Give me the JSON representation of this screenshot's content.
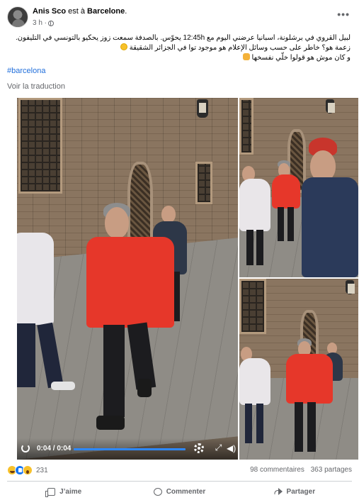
{
  "post": {
    "author": "Anis Sco",
    "author_suffix": " est à ",
    "location": "Barcelone",
    "location_end": ".",
    "time": "3 h ·",
    "more_icon": "more-options-icon",
    "privacy_icon": "globe-icon",
    "text_lines": [
      "لبيل القروي في برشلونة، اسبانيا عرضني اليوم مع 12:45h يحوّس. بالصدفة سمعت زوز يحكيو بالتونسي في التليفون.",
      "زعمة هو؟ خاطر على حسب وسائل الإعلام هو موجود توا في الجزائر الشقيقة",
      "و كان موش هو قولوا خلّي نفسخها"
    ],
    "hashtag": "#barcelona",
    "translate_link": "Voir la traduction"
  },
  "video": {
    "time": "0:04 / 0:04",
    "progress": 1.0,
    "progress_color": "#2d88ff",
    "icons": [
      "replay-icon",
      "gear-icon",
      "fullscreen-icon",
      "volume-icon"
    ]
  },
  "stats": {
    "reactions": [
      "haha",
      "like",
      "wow"
    ],
    "reaction_count": "231",
    "comments": "98 commentaires",
    "shares": "363 partages"
  },
  "actions": {
    "like": "J’aime",
    "comment": "Commenter",
    "share": "Partager"
  },
  "colors": {
    "accent": "#1877f2",
    "link": "#216fdb",
    "jacket": "#e6372a",
    "muted_text": "#65676b"
  }
}
